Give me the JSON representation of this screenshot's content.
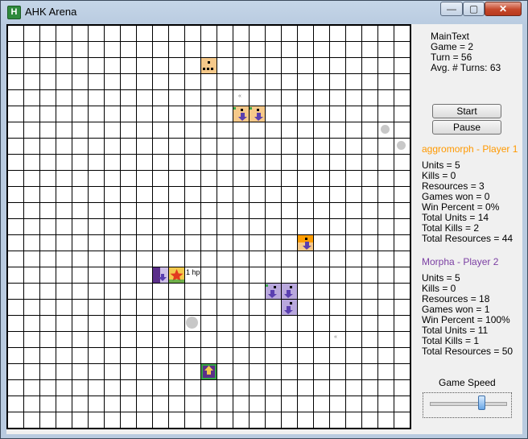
{
  "window": {
    "title": "AHK Arena",
    "app_icon": "H",
    "controls": {
      "minimize": "—",
      "maximize": "▢",
      "close": "✕"
    }
  },
  "icons": {
    "app": "app-icon",
    "minimize": "minimize-icon",
    "maximize": "maximize-icon",
    "close": "close-icon"
  },
  "colors": {
    "player1": "#ff9900",
    "player2": "#7b3fa3",
    "resource": "#c8c8c8"
  },
  "arena": {
    "hp_label": "1 hp",
    "tiny_labels": [
      "«",
      "«"
    ]
  },
  "info": {
    "main_text": "MainText",
    "game": "Game = 2",
    "turn": "Turn = 56",
    "avg_turns": "Avg. # Turns: 63"
  },
  "buttons": {
    "start": "Start",
    "pause": "Pause"
  },
  "player1": {
    "title": "aggromorph - Player 1",
    "stats": [
      "Units = 5",
      "Kills = 0",
      "Resources = 3",
      "Games won = 0",
      "Win Percent = 0%",
      "Total Units = 14",
      "Total Kills = 2",
      "Total Resources = 44"
    ]
  },
  "player2": {
    "title": "Morpha - Player 2",
    "stats": [
      "Units = 5",
      "Kills = 0",
      "Resources = 18",
      "Games won = 1",
      "Win Percent = 100%",
      "Total Units = 11",
      "Total Kills = 1",
      "Total Resources = 50"
    ]
  },
  "game_speed": {
    "label": "Game Speed",
    "level": 0.7
  }
}
